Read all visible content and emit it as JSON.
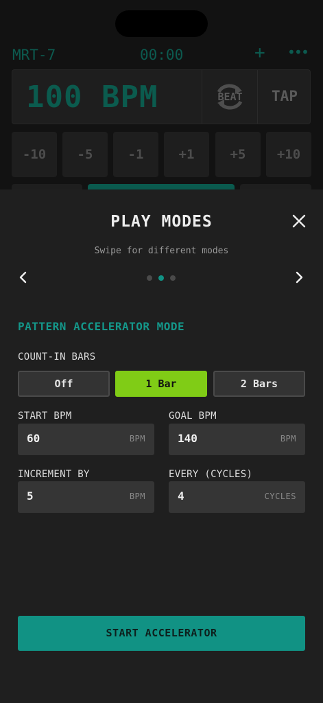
{
  "app": {
    "device_name": "MRT-7",
    "timer": "00:00",
    "tempo_readout": "100 BPM",
    "beat_label": "BEAT",
    "tap_label": "TAP",
    "steps": [
      "-10",
      "-5",
      "-1",
      "+1",
      "+5",
      "+10"
    ]
  },
  "modal": {
    "title": "PLAY MODES",
    "subtitle": "Swipe for different modes",
    "page_count": 3,
    "active_page": 2,
    "mode_heading": "PATTERN ACCELERATOR MODE",
    "count_in": {
      "label": "COUNT-IN BARS",
      "options": [
        "Off",
        "1 Bar",
        "2 Bars"
      ],
      "selected": "1 Bar"
    },
    "start_bpm": {
      "label": "START BPM",
      "value": "60",
      "unit": "BPM"
    },
    "goal_bpm": {
      "label": "GOAL BPM",
      "value": "140",
      "unit": "BPM"
    },
    "increment": {
      "label": "INCREMENT BY",
      "value": "5",
      "unit": "BPM"
    },
    "every": {
      "label": "EVERY (CYCLES)",
      "value": "4",
      "unit": "CYCLES"
    },
    "start_button": "START ACCELERATOR"
  },
  "colors": {
    "accent_teal": "#119284",
    "selected_green": "#80cc16",
    "sheet_bg": "#1f1f1f",
    "input_bg": "#353535"
  },
  "icons": {
    "add": "plus-icon",
    "more": "more-icon",
    "beat": "refresh-arrows-icon",
    "close": "close-icon",
    "prev": "chevron-left-icon",
    "next": "chevron-right-icon"
  }
}
